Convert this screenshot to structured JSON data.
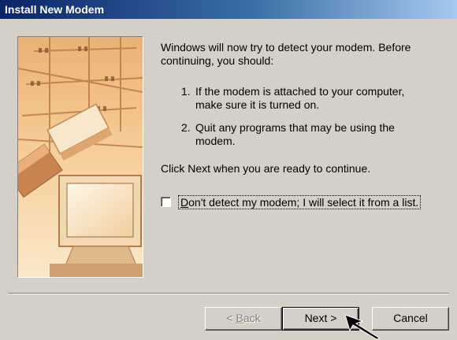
{
  "window": {
    "title": "Install New Modem"
  },
  "content": {
    "intro": "Windows will now try to detect your modem.  Before continuing, you should:",
    "steps": [
      {
        "number": "1.",
        "text": "If the modem is attached to your computer, make sure it is turned on."
      },
      {
        "number": "2.",
        "text": "Quit any programs that may be using the modem."
      }
    ],
    "continue_text": "Click Next when you are ready to continue.",
    "checkbox": {
      "label_access": "D",
      "label_rest": "on't detect my modem; I will select it from a list.",
      "checked": false
    }
  },
  "buttons": {
    "back_prefix": "< ",
    "back_access": "B",
    "back_rest": "ack",
    "next": "Next >",
    "cancel": "Cancel"
  },
  "icons": {
    "illustration": "modem-wizard-illustration",
    "cursor": "arrow-cursor-icon"
  },
  "colors": {
    "titlebar_start": "#0a246a",
    "titlebar_end": "#a6caf0",
    "dialog_bg": "#d4d0c8"
  }
}
